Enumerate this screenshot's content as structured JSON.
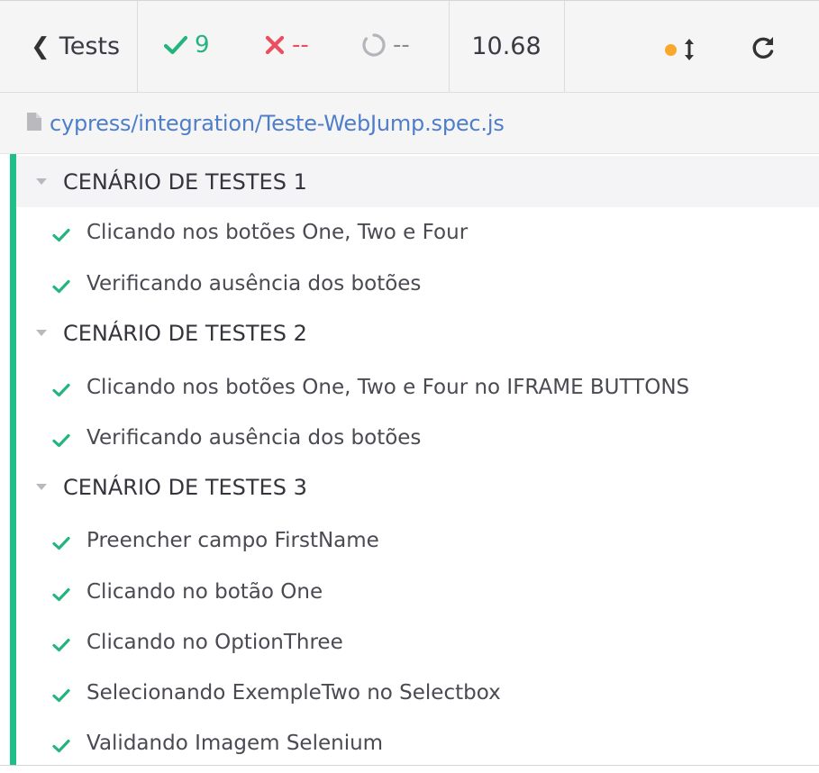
{
  "header": {
    "tests_label": "Tests",
    "passed_count": "9",
    "failed_count": "--",
    "pending_count": "--",
    "duration": "10.68"
  },
  "spec": {
    "path": "cypress/integration/Teste-WebJump.spec.js"
  },
  "suites": [
    {
      "title": "CENÁRIO DE TESTES 1",
      "tests": [
        "Clicando nos botões One, Two e Four",
        "Verificando ausência dos botões"
      ]
    },
    {
      "title": "CENÁRIO DE TESTES 2",
      "tests": [
        "Clicando nos botões One, Two e Four no IFRAME BUTTONS",
        "Verificando ausência dos botões"
      ]
    },
    {
      "title": "CENÁRIO DE TESTES 3",
      "tests": [
        "Preencher campo FirstName",
        "Clicando no botão One",
        "Clicando no OptionThree",
        "Selecionando ExempleTwo no Selectbox",
        "Validando Imagem Selenium"
      ]
    }
  ],
  "colors": {
    "pass": "#24b47e",
    "fail": "#e94f5f",
    "pending": "#8a8a92",
    "accent_bar": "#1fbf88",
    "status_dot": "#f8a82a",
    "link": "#4f7ec9"
  },
  "icons": {
    "back": "chevron-left-icon",
    "passed": "check-icon",
    "failed": "x-icon",
    "pending": "circle-notch-icon",
    "status": "dot-icon",
    "scroll": "arrows-vertical-icon",
    "reload": "redo-icon",
    "file": "file-icon",
    "collapse": "caret-down-icon"
  }
}
